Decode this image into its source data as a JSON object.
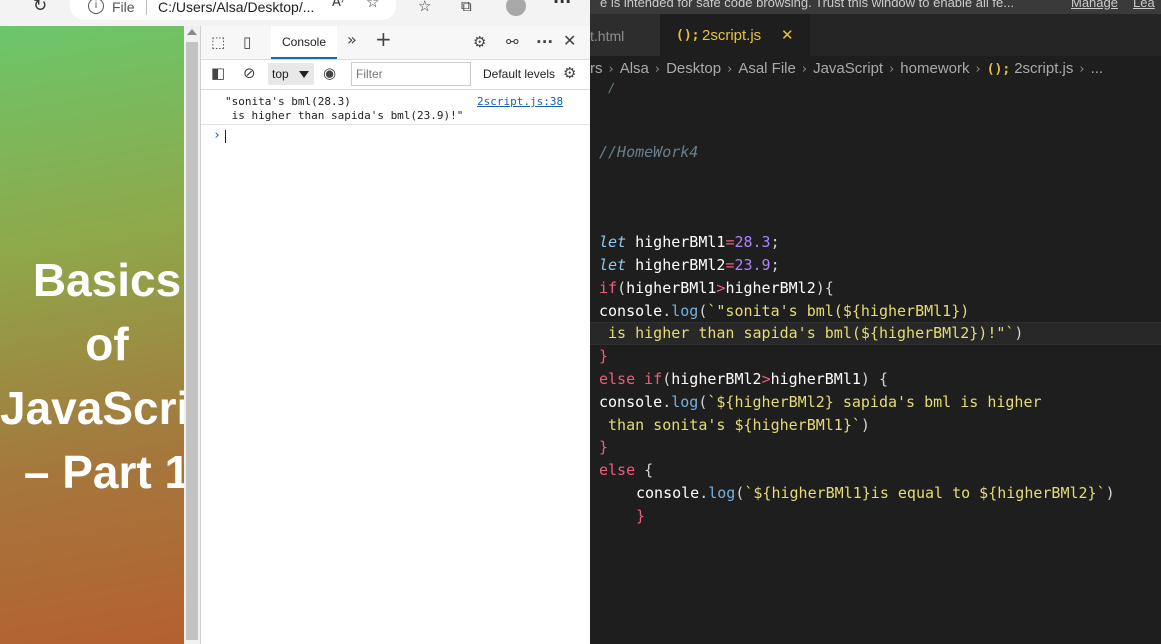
{
  "browser": {
    "toolbar": {
      "refresh_icon": "refresh-icon",
      "info_icon_glyph": "i",
      "file_label": "File",
      "url": "C:/Users/Alsa/Desktop/...",
      "read_aloud_icon": "A⁾",
      "more_label": "···"
    },
    "page": {
      "title_lines": [
        "Basics",
        "of",
        "JavaScript",
        "– Part 1"
      ]
    },
    "devtools": {
      "tab_console": "Console",
      "more_tabs": "»",
      "add_tab": "+",
      "close": "✕",
      "context": "top",
      "filter_placeholder": "Filter",
      "levels": "Default levels",
      "message_line1": "\"sonita's bml(28.3)",
      "message_line2": " is higher than sapida's bml(23.9)!\"",
      "message_source": "2script.js:38",
      "prompt": "›"
    }
  },
  "editor": {
    "banner": {
      "text": "e is intended for safe code browsing. Trust this window to enable all fe...",
      "manage": "Manage",
      "learn": "Lea"
    },
    "tabs": [
      {
        "label": "t.html"
      },
      {
        "icon": "();",
        "label": "2script.js",
        "close": "✕"
      }
    ],
    "breadcrumb": [
      "rs",
      "Alsa",
      "Desktop",
      "Asal File",
      "JavaScript",
      "homework",
      "2script.js",
      "..."
    ],
    "breadcrumb_js_icon": "();",
    "code": {
      "top_fragment": "/",
      "comment": "//HomeWork4",
      "l1_kw": "let",
      "l1_var": "higherBMl1",
      "l1_eq": "=",
      "l1_num": "28.3",
      "l1_end": ";",
      "l2_kw": "let",
      "l2_var": "higherBMl2",
      "l2_eq": "=",
      "l2_num": "23.9",
      "l2_end": ";",
      "l3_if": "if",
      "l3_a": "higherBMl1",
      "l3_op": ">",
      "l3_b": "higherBMl2",
      "l3_end": "){",
      "l4_obj": "console",
      "l4_dot": ".",
      "l4_fn": "log",
      "l4_str": "`\"sonita's bml(${higherBMl1})",
      "l5_str": " is higher than sapida's bml(${higherBMl2})!\"`",
      "l5_end": ")",
      "l6": "}",
      "l7_else": "else if",
      "l7_a": "higherBMl2",
      "l7_op": ">",
      "l7_b": "higherBMl1",
      "l7_end": ") {",
      "l8_obj": "console",
      "l8_dot": ".",
      "l8_fn": "log",
      "l8_str": "`${higherBMl2} sapida's bml is higher",
      "l9_str": " than sonita's ${higherBMl1}`",
      "l9_end": ")",
      "l10": "}",
      "l11_else": "else",
      "l11_end": " {",
      "l12_obj": "console",
      "l12_dot": ".",
      "l12_fn": "log",
      "l12_str": "`${higherBMl1}is equal to ${higherBMl2}`",
      "l12_end": ")",
      "l13": "}"
    }
  }
}
